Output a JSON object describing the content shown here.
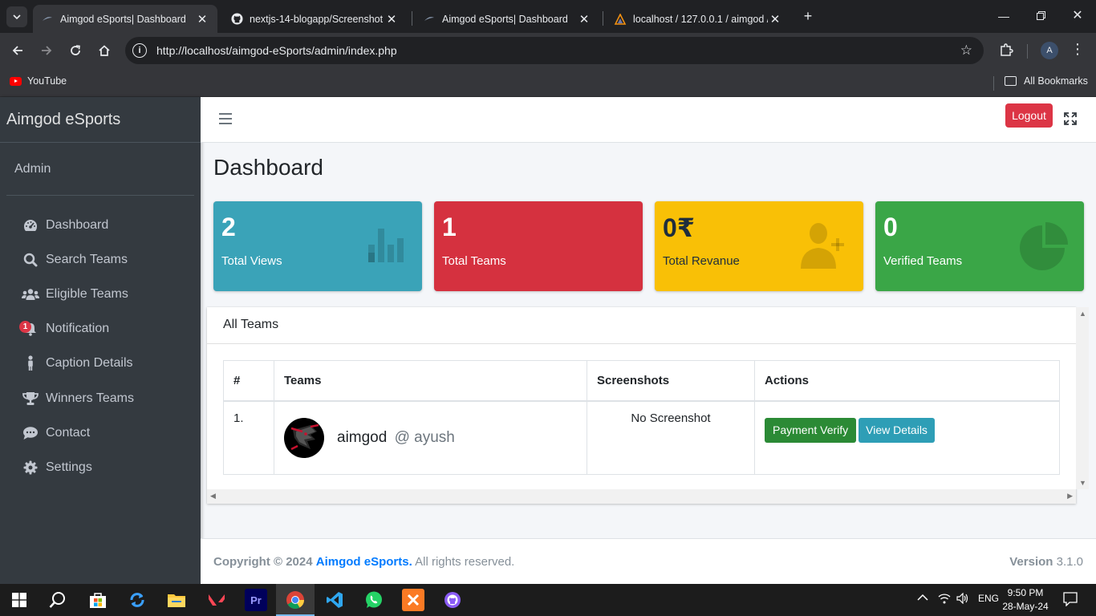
{
  "browser": {
    "tabs": [
      {
        "title": "Aimgod eSports| Dashboard",
        "active": true
      },
      {
        "title": "nextjs-14-blogapp/Screenshot",
        "active": false
      },
      {
        "title": "Aimgod eSports| Dashboard",
        "active": false
      },
      {
        "title": "localhost / 127.0.0.1 / aimgod /",
        "active": false
      }
    ],
    "url": "http://localhost/aimgod-eSports/admin/index.php",
    "profile_initial": "A",
    "bookmarks": {
      "youtube": "YouTube",
      "all": "All Bookmarks"
    }
  },
  "sidebar": {
    "brand": "Aimgod eSports",
    "user": "Admin",
    "items": [
      {
        "label": "Dashboard",
        "icon": "tachometer-icon"
      },
      {
        "label": "Search Teams",
        "icon": "search-icon"
      },
      {
        "label": "Eligible Teams",
        "icon": "users-icon"
      },
      {
        "label": "Notification",
        "icon": "bell-icon",
        "badge": "1"
      },
      {
        "label": "Caption Details",
        "icon": "person-icon"
      },
      {
        "label": "Winners Teams",
        "icon": "trophy-icon"
      },
      {
        "label": "Contact",
        "icon": "comment-icon"
      },
      {
        "label": "Settings",
        "icon": "gear-icon"
      }
    ]
  },
  "topnav": {
    "logout": "Logout"
  },
  "page": {
    "title": "Dashboard"
  },
  "stats": [
    {
      "value": "2",
      "label": "Total Views",
      "icon": "bar-chart-icon",
      "color": "#17a2b8"
    },
    {
      "value": "1",
      "label": "Total Teams",
      "icon": "none",
      "color": "#dc3545"
    },
    {
      "value": "0₹",
      "label": "Total Revanue",
      "icon": "user-plus-icon",
      "color": "#ffc107"
    },
    {
      "value": "0",
      "label": "Verified Teams",
      "icon": "pie-chart-icon",
      "color": "#28a745"
    }
  ],
  "teams_card": {
    "title": "All Teams",
    "columns": [
      "#",
      "Teams",
      "Screenshots",
      "Actions"
    ],
    "rows": [
      {
        "index": "1.",
        "team": "aimgod",
        "user": "@ ayush",
        "screenshot": "No Screenshot",
        "action_verify": "Payment Verify",
        "action_details": "View Details"
      }
    ]
  },
  "footer": {
    "copyright": "Copyright © 2024",
    "brand": "Aimgod eSports.",
    "rights": "All rights reserved.",
    "version_label": "Version",
    "version": "3.1.0"
  },
  "taskbar": {
    "time": "9:50 PM",
    "date": "28-May-24",
    "lang": "ENG"
  }
}
